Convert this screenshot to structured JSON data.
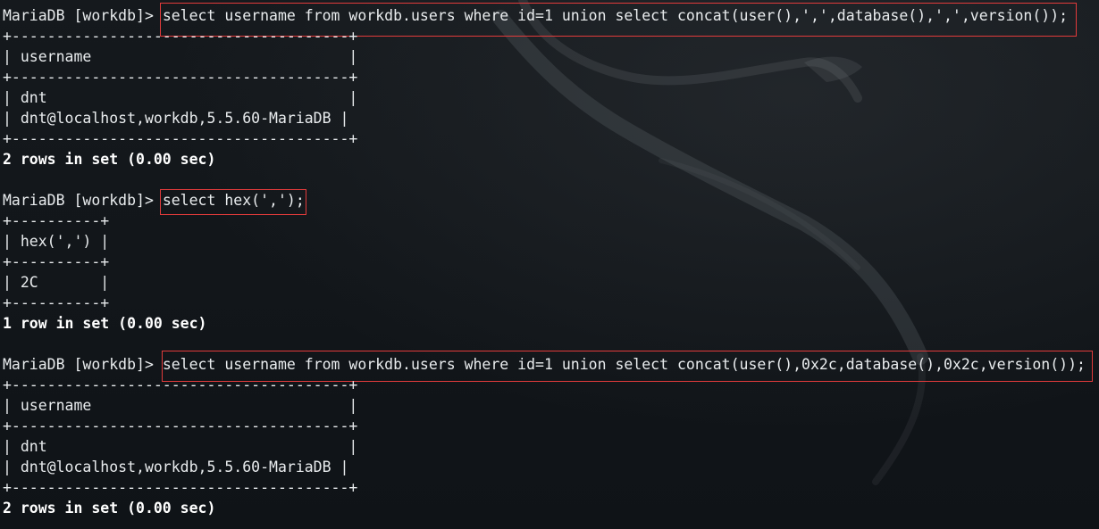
{
  "terminal": {
    "blocks": [
      {
        "prompt": "MariaDB [workdb]> ",
        "command": "select username from workdb.users where id=1 union select concat(user(),',',database(),',',version());",
        "table": [
          "+--------------------------------------+",
          "| username                             |",
          "+--------------------------------------+",
          "| dnt                                  |",
          "| dnt@localhost,workdb,5.5.60-MariaDB |",
          "+--------------------------------------+"
        ],
        "status": "2 rows in set (0.00 sec)"
      },
      {
        "prompt": "MariaDB [workdb]> ",
        "command": "select hex(',');",
        "table": [
          "+----------+",
          "| hex(',') |",
          "+----------+",
          "| 2C       |",
          "+----------+"
        ],
        "status": "1 row in set (0.00 sec)"
      },
      {
        "prompt": "MariaDB [workdb]> ",
        "command": "select username from workdb.users where id=1 union select concat(user(),0x2c,database(),0x2c,version());",
        "table": [
          "+--------------------------------------+",
          "| username                             |",
          "+--------------------------------------+",
          "| dnt                                  |",
          "| dnt@localhost,workdb,5.5.60-MariaDB |",
          "+--------------------------------------+"
        ],
        "status": "2 rows in set (0.00 sec)"
      }
    ]
  },
  "colors": {
    "background": "#11161a",
    "text": "#e9ecee",
    "highlight_border": "#e23b3b"
  }
}
